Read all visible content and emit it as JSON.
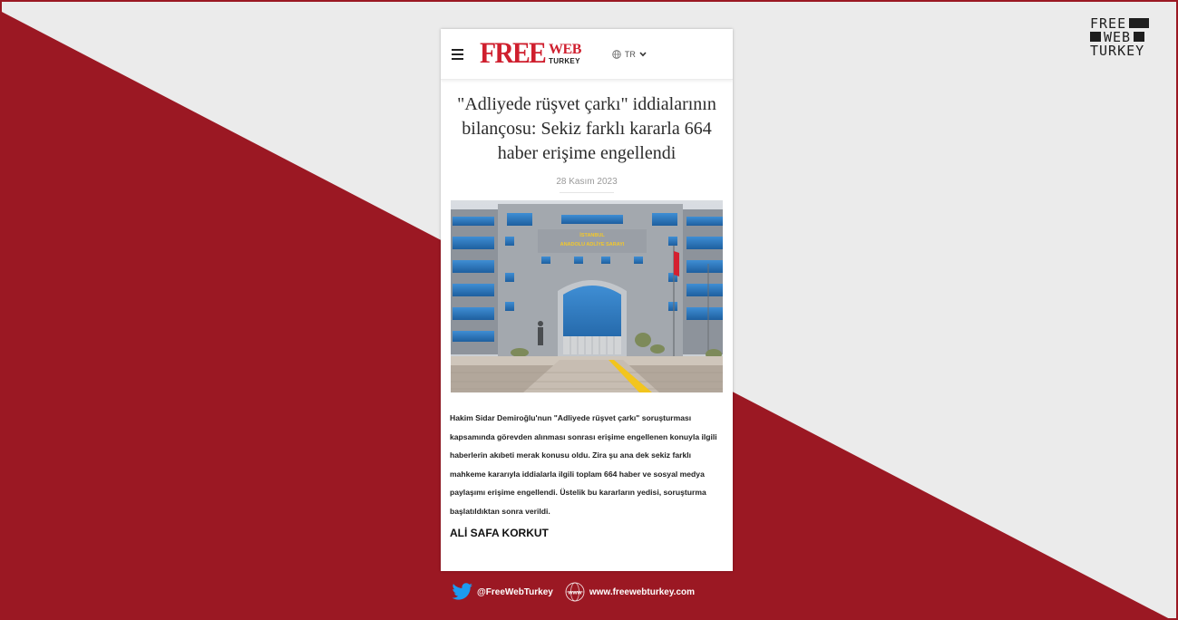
{
  "brand_corner": {
    "line1": "FREE",
    "line2": "WEB",
    "line3": "TURKEY"
  },
  "header": {
    "logo_free": "FREE",
    "logo_web": "WEB",
    "logo_turkey": "TURKEY",
    "language": "TR",
    "menu_icon": "hamburger-icon",
    "language_icon": "globe-icon"
  },
  "article": {
    "title": "\"Adliyede rüşvet çarkı\" iddialarının bilançosu: Sekiz farklı kararla 664 haber erişime engellendi",
    "date": "28 Kasım 2023",
    "photo_sign_line1": "İSTANBUL",
    "photo_sign_line2": "ANADOLU ADLİYE SARAYI",
    "body": "Hakim Sidar Demiroğlu'nun \"Adliyede rüşvet çarkı\" soruşturması kapsamında görevden alınması sonrası erişime engellenen konuyla ilgili haberlerin akıbeti merak konusu oldu. Zira şu ana dek sekiz farklı mahkeme kararıyla iddialarla ilgili toplam 664 haber ve sosyal medya paylaşımı erişime engellendi. Üstelik bu kararların yedisi, soruşturma başlatıldıktan sonra verildi.",
    "author": "ALİ SAFA KORKUT"
  },
  "footer": {
    "twitter_handle": "@FreeWebTurkey",
    "website": "www.freewebturkey.com",
    "www_badge": "www"
  },
  "colors": {
    "brand_red": "#cf1f2e",
    "background_red": "#9b1823",
    "background_light": "#ebebeb",
    "twitter_blue": "#1d9bf0"
  }
}
